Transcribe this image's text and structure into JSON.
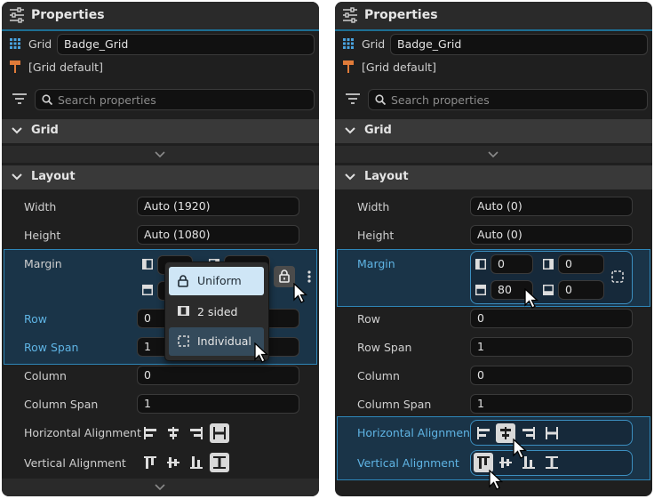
{
  "panels": [
    {
      "title": "Properties",
      "element_type": "Grid",
      "element_name": "Badge_Grid",
      "style_label": "[Grid default]",
      "search_placeholder": "Search properties",
      "sections": {
        "grid": "Grid",
        "layout": "Layout"
      },
      "rows": {
        "width": {
          "label": "Width",
          "value": "Auto (1920)"
        },
        "height": {
          "label": "Height",
          "value": "Auto (1080)"
        },
        "margin": {
          "label": "Margin"
        },
        "row": {
          "label": "Row",
          "value": "0"
        },
        "row_span": {
          "label": "Row Span",
          "value": "1"
        },
        "column": {
          "label": "Column",
          "value": "0"
        },
        "column_span": {
          "label": "Column Span",
          "value": "1"
        },
        "h_align": {
          "label": "Horizontal Alignment",
          "selected": "stretch"
        },
        "v_align": {
          "label": "Vertical Alignment",
          "selected": "stretch"
        }
      },
      "margin_menu": {
        "items": [
          "Uniform",
          "2 sided",
          "Individual"
        ],
        "hovered": "Uniform",
        "selected": "Individual"
      }
    },
    {
      "title": "Properties",
      "element_type": "Grid",
      "element_name": "Badge_Grid",
      "style_label": "[Grid default]",
      "search_placeholder": "Search properties",
      "sections": {
        "grid": "Grid",
        "layout": "Layout"
      },
      "rows": {
        "width": {
          "label": "Width",
          "value": "Auto (0)"
        },
        "height": {
          "label": "Height",
          "value": "Auto (0)"
        },
        "margin": {
          "label": "Margin",
          "left": "0",
          "right": "0",
          "top": "80",
          "bottom": "0"
        },
        "row": {
          "label": "Row",
          "value": "0"
        },
        "row_span": {
          "label": "Row Span",
          "value": "1"
        },
        "column": {
          "label": "Column",
          "value": "0"
        },
        "column_span": {
          "label": "Column Span",
          "value": "1"
        },
        "h_align": {
          "label": "Horizontal Alignment",
          "selected": "center"
        },
        "v_align": {
          "label": "Vertical Alignment",
          "selected": "top"
        }
      }
    }
  ],
  "colors": {
    "accent": "#2e86b8",
    "label_highlight": "#5fb4e4",
    "panel_bg": "#1f1f1f"
  },
  "icons": [
    "sliders-icon",
    "grid-icon",
    "brush-icon",
    "filter-icon",
    "search-icon",
    "chevron-down-icon",
    "margin-left-icon",
    "margin-right-icon",
    "margin-top-icon",
    "margin-bottom-icon",
    "lock-icon",
    "more-icon",
    "individual-margin-icon",
    "align-left-icon",
    "align-center-icon",
    "align-right-icon",
    "align-stretch-icon",
    "align-top-icon",
    "align-middle-icon",
    "align-bottom-icon",
    "cursor-icon"
  ]
}
